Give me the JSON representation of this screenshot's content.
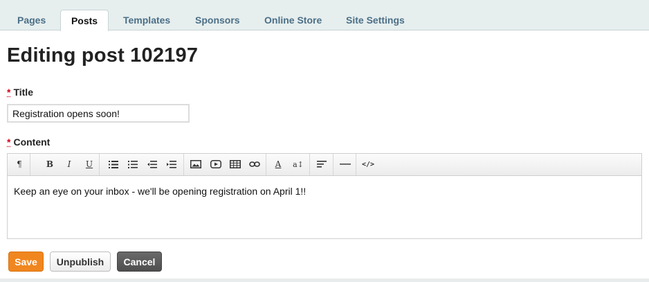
{
  "tabs": [
    {
      "label": "Pages"
    },
    {
      "label": "Posts",
      "active": true
    },
    {
      "label": "Templates"
    },
    {
      "label": "Sponsors"
    },
    {
      "label": "Online Store"
    },
    {
      "label": "Site Settings"
    }
  ],
  "page_title": "Editing post 102197",
  "form": {
    "required_marker": "*",
    "title_label": "Title",
    "title_value": "Registration opens soon!",
    "content_label": "Content",
    "content_text": "Keep an eye on your inbox - we'll be opening registration on April 1!!"
  },
  "toolbar": {
    "paragraph_glyph": "¶",
    "bold_glyph": "B",
    "italic_glyph": "I",
    "underline_glyph": "U",
    "font_color_glyph": "A",
    "font_size_glyph": "a↕",
    "code_glyph": "</>",
    "icons": [
      "paragraph-format-icon",
      "bold-icon",
      "italic-icon",
      "underline-icon",
      "unordered-list-icon",
      "ordered-list-icon",
      "outdent-icon",
      "indent-icon",
      "image-icon",
      "video-icon",
      "table-icon",
      "link-icon",
      "font-color-icon",
      "font-size-icon",
      "align-icon",
      "horizontal-rule-icon",
      "code-view-icon"
    ]
  },
  "buttons": {
    "save": "Save",
    "unpublish": "Unpublish",
    "cancel": "Cancel"
  },
  "colors": {
    "tab_text": "#4b6f86",
    "save_button": "#f0861f",
    "cancel_button": "#555555",
    "required": "#d0021b"
  }
}
